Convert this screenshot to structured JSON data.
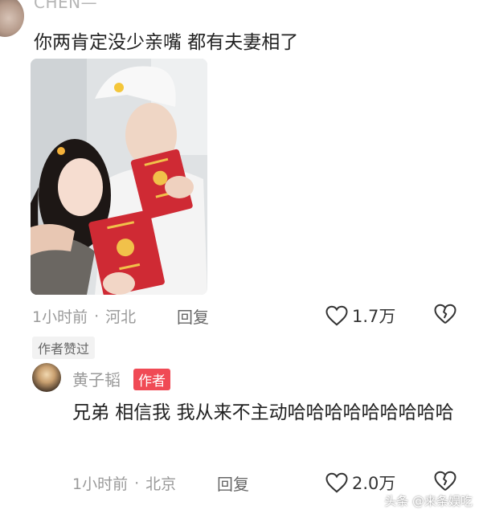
{
  "comment": {
    "username": "CHEN—",
    "text": "你两肯定没少亲嘴 都有夫妻相了",
    "time": "1小时前",
    "location": "河北",
    "reply_label": "回复",
    "likes": "1.7万",
    "author_liked_badge": "作者赞过"
  },
  "reply": {
    "username": "黄子韬",
    "author_badge": "作者",
    "text": "兄弟 相信我 我从来不主动哈哈哈哈哈哈哈哈哈",
    "time": "1小时前",
    "location": "北京",
    "reply_label": "回复",
    "likes": "2.0万"
  },
  "watermark": "头条 @来条娱吃",
  "colors": {
    "badge_red": "#f04a55",
    "meta_gray": "#999999",
    "text_dark": "#222222"
  },
  "icons": [
    "heart-outline-icon",
    "broken-heart-icon"
  ]
}
